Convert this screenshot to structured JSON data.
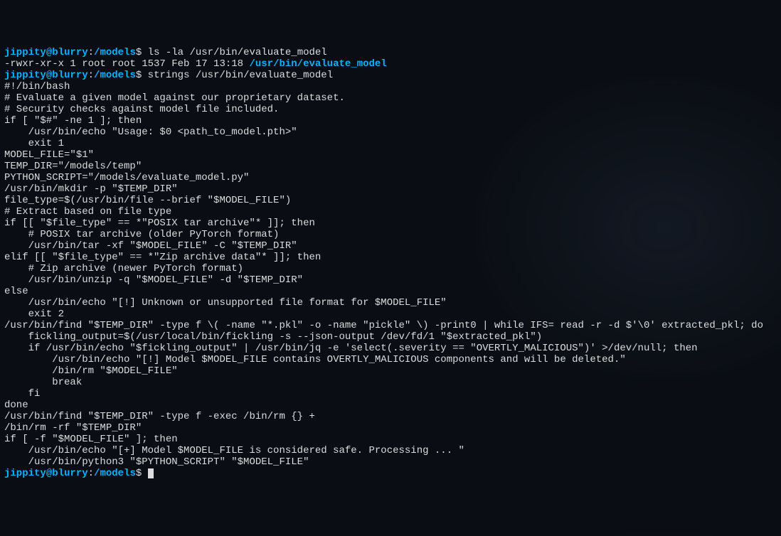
{
  "prompt": {
    "user": "jippity",
    "at": "@",
    "host": "blurry",
    "colon": ":",
    "path": "/models",
    "dollar": "$"
  },
  "cmd1": " ls -la /usr/bin/evaluate_model",
  "ls_output": {
    "perms": "-rwxr-xr-x 1 root root 1537 Feb 17 13:18 ",
    "filepath": "/usr/bin/evaluate_model"
  },
  "cmd2": " strings /usr/bin/evaluate_model",
  "script_lines": [
    "#!/bin/bash",
    "# Evaluate a given model against our proprietary dataset.",
    "# Security checks against model file included.",
    "if [ \"$#\" -ne 1 ]; then",
    "    /usr/bin/echo \"Usage: $0 <path_to_model.pth>\"",
    "    exit 1",
    "MODEL_FILE=\"$1\"",
    "TEMP_DIR=\"/models/temp\"",
    "PYTHON_SCRIPT=\"/models/evaluate_model.py\"",
    "/usr/bin/mkdir -p \"$TEMP_DIR\"",
    "file_type=$(/usr/bin/file --brief \"$MODEL_FILE\")",
    "# Extract based on file type",
    "if [[ \"$file_type\" == *\"POSIX tar archive\"* ]]; then",
    "    # POSIX tar archive (older PyTorch format)",
    "    /usr/bin/tar -xf \"$MODEL_FILE\" -C \"$TEMP_DIR\"",
    "elif [[ \"$file_type\" == *\"Zip archive data\"* ]]; then",
    "    # Zip archive (newer PyTorch format)",
    "    /usr/bin/unzip -q \"$MODEL_FILE\" -d \"$TEMP_DIR\"",
    "else",
    "    /usr/bin/echo \"[!] Unknown or unsupported file format for $MODEL_FILE\"",
    "    exit 2",
    "/usr/bin/find \"$TEMP_DIR\" -type f \\( -name \"*.pkl\" -o -name \"pickle\" \\) -print0 | while IFS= read -r -d $'\\0' extracted_pkl; do",
    "    fickling_output=$(/usr/local/bin/fickling -s --json-output /dev/fd/1 \"$extracted_pkl\")",
    "    if /usr/bin/echo \"$fickling_output\" | /usr/bin/jq -e 'select(.severity == \"OVERTLY_MALICIOUS\")' >/dev/null; then",
    "        /usr/bin/echo \"[!] Model $MODEL_FILE contains OVERTLY_MALICIOUS components and will be deleted.\"",
    "        /bin/rm \"$MODEL_FILE\"",
    "        break",
    "    fi",
    "done",
    "/usr/bin/find \"$TEMP_DIR\" -type f -exec /bin/rm {} +",
    "/bin/rm -rf \"$TEMP_DIR\"",
    "if [ -f \"$MODEL_FILE\" ]; then",
    "    /usr/bin/echo \"[+] Model $MODEL_FILE is considered safe. Processing ... \"",
    "    /usr/bin/python3 \"$PYTHON_SCRIPT\" \"$MODEL_FILE\""
  ],
  "cmd3": " "
}
